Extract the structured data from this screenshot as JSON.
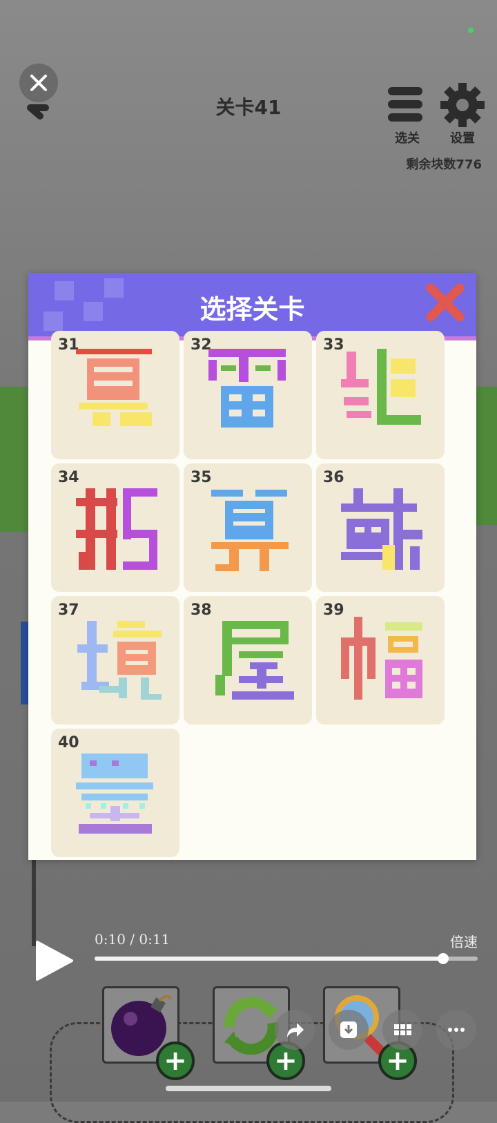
{
  "header": {
    "level_title": "关卡41",
    "menu_label": "选关",
    "settings_label": "设置",
    "remaining": "剩余块数776"
  },
  "modal": {
    "title": "选择关卡",
    "levels": [
      {
        "num": "31",
        "char": "夏"
      },
      {
        "num": "32",
        "char": "雷"
      },
      {
        "num": "33",
        "char": "继"
      },
      {
        "num": "34",
        "char": "鹅"
      },
      {
        "num": "35",
        "char": "算"
      },
      {
        "num": "36",
        "char": "戴"
      },
      {
        "num": "37",
        "char": "境"
      },
      {
        "num": "38",
        "char": "屋"
      },
      {
        "num": "39",
        "char": "幅"
      },
      {
        "num": "40",
        "char": "墨"
      }
    ]
  },
  "player": {
    "time": "0:10 / 0:11",
    "speed_label": "倍速",
    "progress": 0.91
  },
  "colors": {
    "header_purple": "#7569e6",
    "modal_close_red": "#e0584f",
    "card_bg": "#f1ead6"
  }
}
